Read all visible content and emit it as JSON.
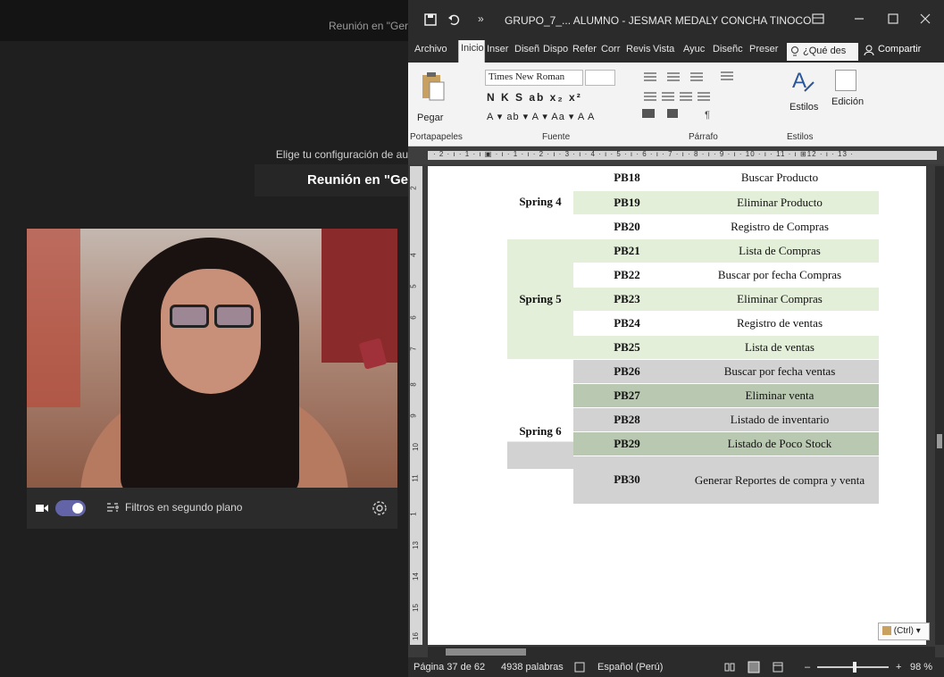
{
  "teams": {
    "titlebar_text": "Reunión en \"Ger",
    "subtitle": "Elige tu configuración de au",
    "meeting_title": "Reunión en \"Ge",
    "background_filters_label": "Filtros en segundo plano",
    "camera_on": true
  },
  "word": {
    "title": "GRUPO_7_...   ALUMNO - JESMAR MEDALY CONCHA TINOCO",
    "more_glyph": "»",
    "tabs": [
      "Archivo",
      "Inicio",
      "Inser",
      "Diseñ",
      "Dispo",
      "Refer",
      "Corr",
      "Revis",
      "Vista",
      "Ayuc",
      "Diseñc",
      "Preser"
    ],
    "active_tab": "Inicio",
    "tell_me": "¿Qué des",
    "share": "Compartir",
    "ribbon": {
      "paste_label": "Pegar",
      "font_name": "Times New Roman",
      "format_row": "N K S ab x₂ x²",
      "format_row2": "A ▾ ab ▾ A ▾ Aa ▾   A  A",
      "styles_label": "Estilos",
      "editing_label": "Edición",
      "groups": [
        "Portapapeles",
        "Fuente",
        "Párrafo",
        "Estilos"
      ]
    },
    "ruler_marks": "· 2 · ı · 1 · ı ▣ · ı · 1 · ı · 2 · ı · 3 · ı · 4 · ı · 5 · ı · 6 · ı · 7 · ı · 8 · ı · 9 · ı · 10 · ı · 11 · ı ⊞12 · ı · 13 ·",
    "vruler_marks": [
      "2",
      "4",
      "5",
      "6",
      "7",
      "8",
      "9",
      "10",
      "11",
      "1",
      "13",
      "14",
      "15",
      "16"
    ],
    "paste_options": "(Ctrl)",
    "status": {
      "page": "Página 37 de 62",
      "words": "4938 palabras",
      "language": "Español (Perú)",
      "zoom": "98 %"
    },
    "table": {
      "rows": [
        {
          "sprint": "Spring 4",
          "span": 3,
          "code": "PB18",
          "desc": "Buscar Producto",
          "bg": "w"
        },
        {
          "code": "PB19",
          "desc": "Eliminar Producto",
          "bg": "g"
        },
        {
          "code": "PB20",
          "desc": "Registro de Compras",
          "bg": "w"
        },
        {
          "sprint": "Spring 5",
          "span": 5,
          "code": "PB21",
          "desc": "Lista de Compras",
          "bg": "g"
        },
        {
          "code": "PB22",
          "desc": "Buscar por fecha Compras",
          "bg": "w"
        },
        {
          "code": "PB23",
          "desc": "Eliminar Compras",
          "bg": "g"
        },
        {
          "code": "PB24",
          "desc": "Registro de ventas",
          "bg": "w"
        },
        {
          "code": "PB25",
          "desc": "Lista de ventas",
          "bg": "g"
        },
        {
          "sprint": "Spring 6",
          "span": 6,
          "code": "PB26",
          "desc": "Buscar por fecha ventas",
          "bg": "s"
        },
        {
          "code": "PB27",
          "desc": "Eliminar venta",
          "bg": "d"
        },
        {
          "code": "PB28",
          "desc": "Listado de inventario",
          "bg": "s"
        },
        {
          "code": "PB29",
          "desc": "Listado de Poco Stock",
          "bg": "d"
        },
        {
          "code": "PB30",
          "desc": "Generar Reportes de compra y venta",
          "bg": "s",
          "tall": true
        }
      ]
    }
  },
  "colors": {
    "teams_accent": "#6264a7",
    "table_green": "#e3efd9",
    "table_gray": "#d2d2d2"
  }
}
